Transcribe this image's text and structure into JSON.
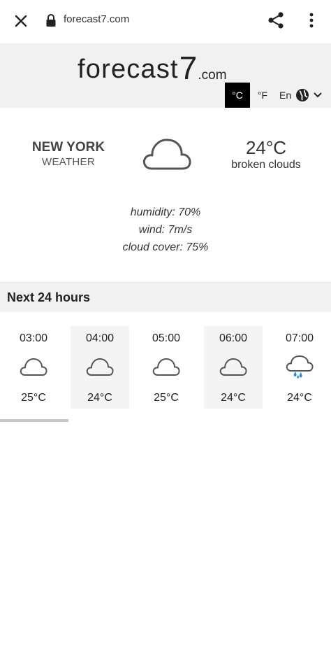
{
  "browser": {
    "url": "forecast7.com",
    "icons": {
      "close": "close-icon",
      "lock": "lock-icon",
      "share": "share-icon",
      "menu": "more-vert-icon"
    }
  },
  "site": {
    "logo_main": "forecast",
    "logo_seven": "7",
    "logo_com": ".com",
    "unit_c": "°C",
    "unit_f": "°F",
    "language": "En",
    "active_unit_color": "#000000"
  },
  "current": {
    "city": "NEW YORK",
    "subtitle": "WEATHER",
    "temperature": "24°C",
    "description": "broken clouds",
    "icon": "cloud-icon",
    "humidity": "humidity: 70%",
    "wind": "wind: 7m/s",
    "cloud_cover": "cloud cover: 75%"
  },
  "next24": {
    "title": "Next 24 hours",
    "hours": [
      {
        "time": "03:00",
        "temp": "25°C",
        "icon": "cloud-icon"
      },
      {
        "time": "04:00",
        "temp": "24°C",
        "icon": "cloud-icon"
      },
      {
        "time": "05:00",
        "temp": "25°C",
        "icon": "cloud-icon"
      },
      {
        "time": "06:00",
        "temp": "24°C",
        "icon": "cloud-icon"
      },
      {
        "time": "07:00",
        "temp": "24°C",
        "icon": "rain-cloud-icon"
      }
    ],
    "rain_color": "#1e88e5"
  }
}
